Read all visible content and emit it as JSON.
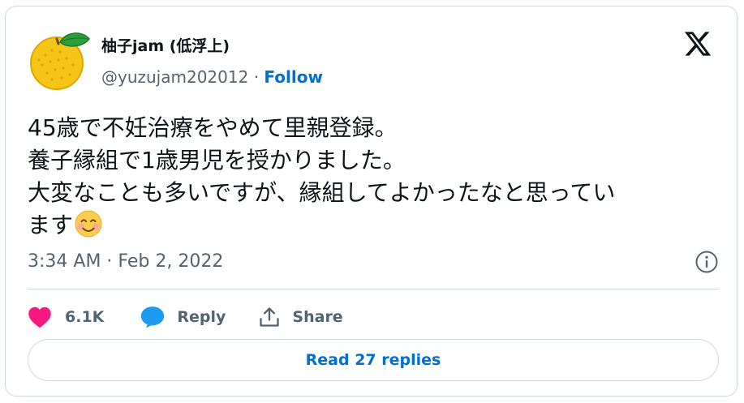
{
  "author": {
    "display_name": "柚子jam (低浮上)",
    "handle": "@yuzujam202012",
    "separator": "·",
    "follow_label": "Follow",
    "avatar_icon": "yuzu-fruit-icon"
  },
  "platform": {
    "logo_icon": "x-logo-icon"
  },
  "tweet": {
    "lines": [
      "45歳で不妊治療をやめて里親登録。",
      "養子縁組で1歳男児を授かりました。",
      "大変なことも多いですが、縁組してよかったなと思ってい",
      "ます"
    ],
    "emoji_icon": "smiling-face-emoji-icon"
  },
  "meta": {
    "timestamp": "3:34 AM · Feb 2, 2022",
    "info_icon": "info-icon"
  },
  "actions": {
    "like_count": "6.1K",
    "reply_label": "Reply",
    "share_label": "Share"
  },
  "footer": {
    "read_replies_label": "Read 27 replies"
  },
  "colors": {
    "link_blue": "#006fd6",
    "like_pink": "#f91880",
    "reply_blue": "#1d9bf0",
    "muted_gray": "#536471",
    "border_gray": "#cfd9de"
  }
}
